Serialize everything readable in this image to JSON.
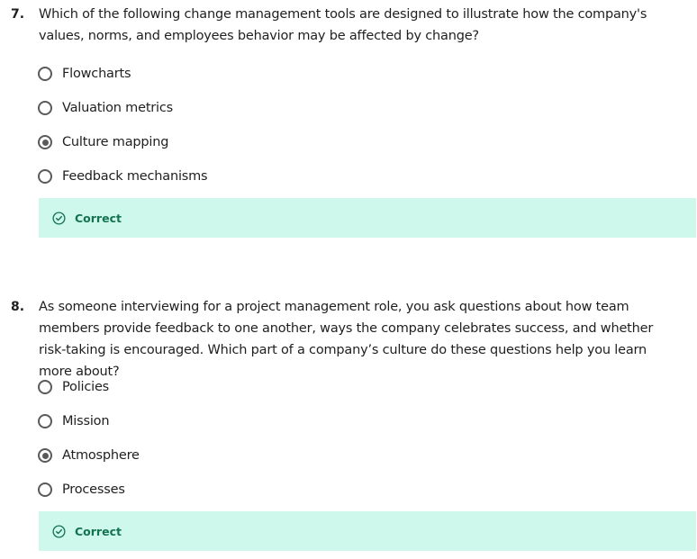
{
  "questions": [
    {
      "number": "7.",
      "text": "Which of the following change management tools are designed to illustrate how the company's values, norms, and employees behavior may be affected by change?",
      "options": [
        {
          "label": "Flowcharts",
          "selected": false
        },
        {
          "label": "Valuation metrics",
          "selected": false
        },
        {
          "label": "Culture mapping",
          "selected": true
        },
        {
          "label": "Feedback mechanisms",
          "selected": false
        }
      ],
      "feedback": {
        "label": "Correct",
        "icon": "check-circle-icon"
      }
    },
    {
      "number": "8.",
      "text": "As someone interviewing for a project management role, you ask questions about how team members provide feedback to one another, ways the company celebrates success, and whether risk-taking is encouraged. Which part of a company’s culture do these questions help you learn more about?",
      "options": [
        {
          "label": "Policies",
          "selected": false
        },
        {
          "label": "Mission",
          "selected": false
        },
        {
          "label": "Atmosphere",
          "selected": true
        },
        {
          "label": "Processes",
          "selected": false
        }
      ],
      "feedback": {
        "label": "Correct",
        "icon": "check-circle-icon"
      }
    }
  ],
  "colors": {
    "correct_bg": "#cff8ec",
    "correct_text": "#137350",
    "radio": "#5a5a5a"
  }
}
